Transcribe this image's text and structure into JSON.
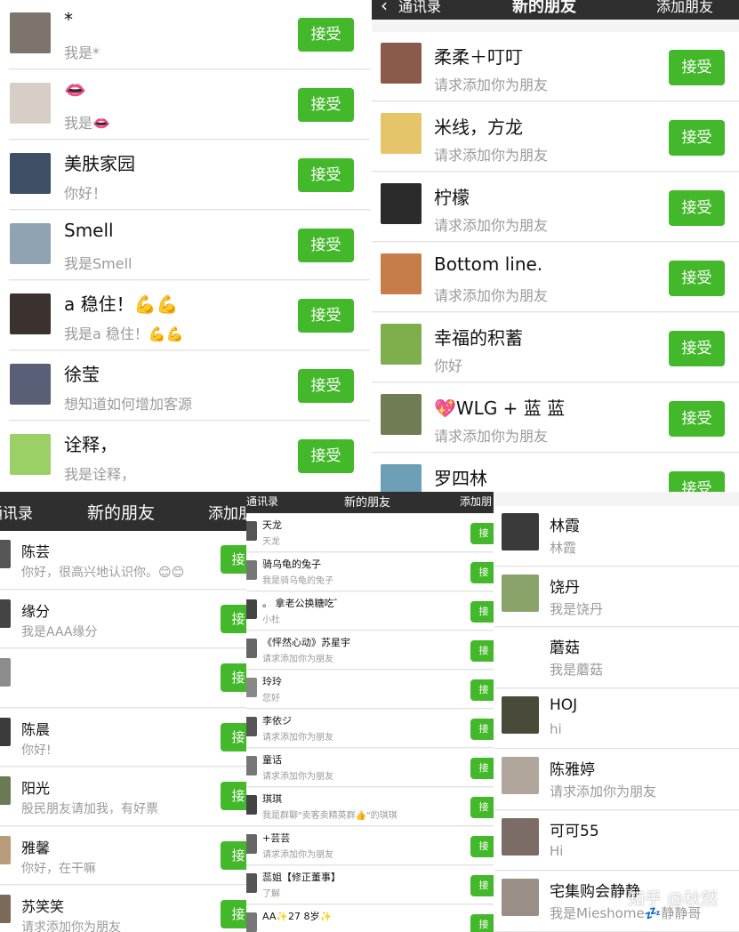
{
  "accent_color": "#43b82a",
  "header_color": "#2f2f2f",
  "watermark": "知乎 @秋然",
  "panel_a": {
    "rows": [
      {
        "name": "*",
        "sub": "我是*",
        "button": "接受",
        "avatar": "#7d756c"
      },
      {
        "name": "👄",
        "sub": "我是👄",
        "button": "接受",
        "avatar": "#d7cfc5"
      },
      {
        "name": "美肤家园",
        "sub": "你好！",
        "button": "接受",
        "avatar": "#3e4f66"
      },
      {
        "name": "Smell",
        "sub": "我是Smell",
        "button": "接受",
        "avatar": "#8fa3b3"
      },
      {
        "name": "a 稳住！💪💪",
        "sub": "我是a 稳住！💪💪",
        "button": "接受",
        "avatar": "#3b3230"
      },
      {
        "name": "徐莹",
        "sub": "想知道如何增加客源",
        "button": "接受",
        "avatar": "#5a5f78"
      },
      {
        "name": "诠释，",
        "sub": "我是诠释，",
        "button": "接受",
        "avatar": "#9bd067"
      }
    ]
  },
  "panel_b": {
    "header": {
      "back": "通讯录",
      "title": "新的朋友",
      "action": "添加朋友"
    },
    "rows": [
      {
        "name": "柔柔＋叮叮",
        "sub": "请求添加你为朋友",
        "button": "接受",
        "avatar": "#8a5a4a"
      },
      {
        "name": "米线，方龙",
        "sub": "请求添加你为朋友",
        "button": "接受",
        "avatar": "#e6c46a"
      },
      {
        "name": "柠檬",
        "sub": "请求添加你为朋友",
        "button": "接受",
        "avatar": "#2b2b2b"
      },
      {
        "name": "Bottom line.",
        "sub": "请求添加你为朋友",
        "button": "接受",
        "avatar": "#c77d4a"
      },
      {
        "name": "幸福的积蓄",
        "sub": "你好",
        "button": "接受",
        "avatar": "#7fae4c"
      },
      {
        "name": "💖WLG + 蓝 蓝",
        "sub": "请求添加你为朋友",
        "button": "接受",
        "avatar": "#6f7c54"
      },
      {
        "name": "罗四林",
        "sub": "",
        "button": "接受",
        "avatar": "#6d9fb6"
      }
    ]
  },
  "panel_c": {
    "header": {
      "back": "通讯录",
      "title": "新的朋友",
      "action": "添加朋"
    },
    "rows": [
      {
        "name": "陈芸",
        "sub": "你好，很高兴地认识你。😊😊",
        "button": "接",
        "avatar": "#555"
      },
      {
        "name": "缘分",
        "sub": "我是AAA缘分",
        "button": "接",
        "avatar": "#444"
      },
      {
        "name": "",
        "sub": "",
        "button": "接",
        "avatar": "#8c8c8c"
      },
      {
        "name": "陈晨",
        "sub": "你好!",
        "button": "接",
        "avatar": "#3b3b3b"
      },
      {
        "name": "阳光",
        "sub": "股民朋友请加我，有好票",
        "button": "接",
        "avatar": "#6a7a55"
      },
      {
        "name": "雅馨",
        "sub": "你好，在干嘛",
        "button": "接",
        "avatar": "#b89b7a"
      },
      {
        "name": "苏笑笑",
        "sub": "请求添加你为朋友",
        "button": "接",
        "avatar": "#7a6a5a"
      }
    ]
  },
  "panel_d": {
    "header": {
      "back": "通讯录",
      "title": "新的朋友",
      "action": "添加朋"
    },
    "rows": [
      {
        "name": "天龙",
        "sub": "天龙",
        "button": "接",
        "avatar": "#555"
      },
      {
        "name": "骑乌龟的兔子",
        "sub": "我是骑乌龟的兔子",
        "button": "接",
        "avatar": "#777"
      },
      {
        "name": "。 拿老公换糖吃゛",
        "sub": "小杜",
        "button": "接",
        "avatar": "#444"
      },
      {
        "name": "《怦然心动》苏星宇",
        "sub": "请求添加你为朋友",
        "button": "接",
        "avatar": "#666"
      },
      {
        "name": "玲玲",
        "sub": "您好",
        "button": "接",
        "avatar": "#888"
      },
      {
        "name": "李依ジ",
        "sub": "请求添加你为朋友",
        "button": "接",
        "avatar": "#555"
      },
      {
        "name": "童话",
        "sub": "请求添加你为朋友",
        "button": "接",
        "avatar": "#777"
      },
      {
        "name": "琪琪",
        "sub": "我是群聊\"卖客卖精英群👍\"的琪琪",
        "button": "接",
        "avatar": "#444"
      },
      {
        "name": "+芸芸",
        "sub": "请求添加你为朋友",
        "button": "接",
        "avatar": "#666"
      },
      {
        "name": "蕊姐【修正董事】",
        "sub": "了解",
        "button": "接",
        "avatar": "#555"
      },
      {
        "name": "AA✨27 8岁✨",
        "sub": "",
        "button": "接",
        "avatar": "#777"
      }
    ]
  },
  "panel_e": {
    "rows": [
      {
        "name": "林霞",
        "sub": "林霞",
        "avatar": "#3a3a3a"
      },
      {
        "name": "饶丹",
        "sub": "我是饶丹",
        "avatar": "#8aa36a"
      },
      {
        "name": "蘑菇",
        "sub": "我是蘑菇",
        "avatar": "#ffffff"
      },
      {
        "name": "HOJ",
        "sub": "hi",
        "avatar": "#4a4a3a"
      },
      {
        "name": "陈雅婷",
        "sub": "请求添加你为朋友",
        "avatar": "#b0a69c"
      },
      {
        "name": "可可55",
        "sub": "Hi",
        "avatar": "#7c6c66"
      },
      {
        "name": "宅集购会静静",
        "sub": "我是Mieshome💤静静哥",
        "avatar": "#9a8f86"
      }
    ]
  }
}
